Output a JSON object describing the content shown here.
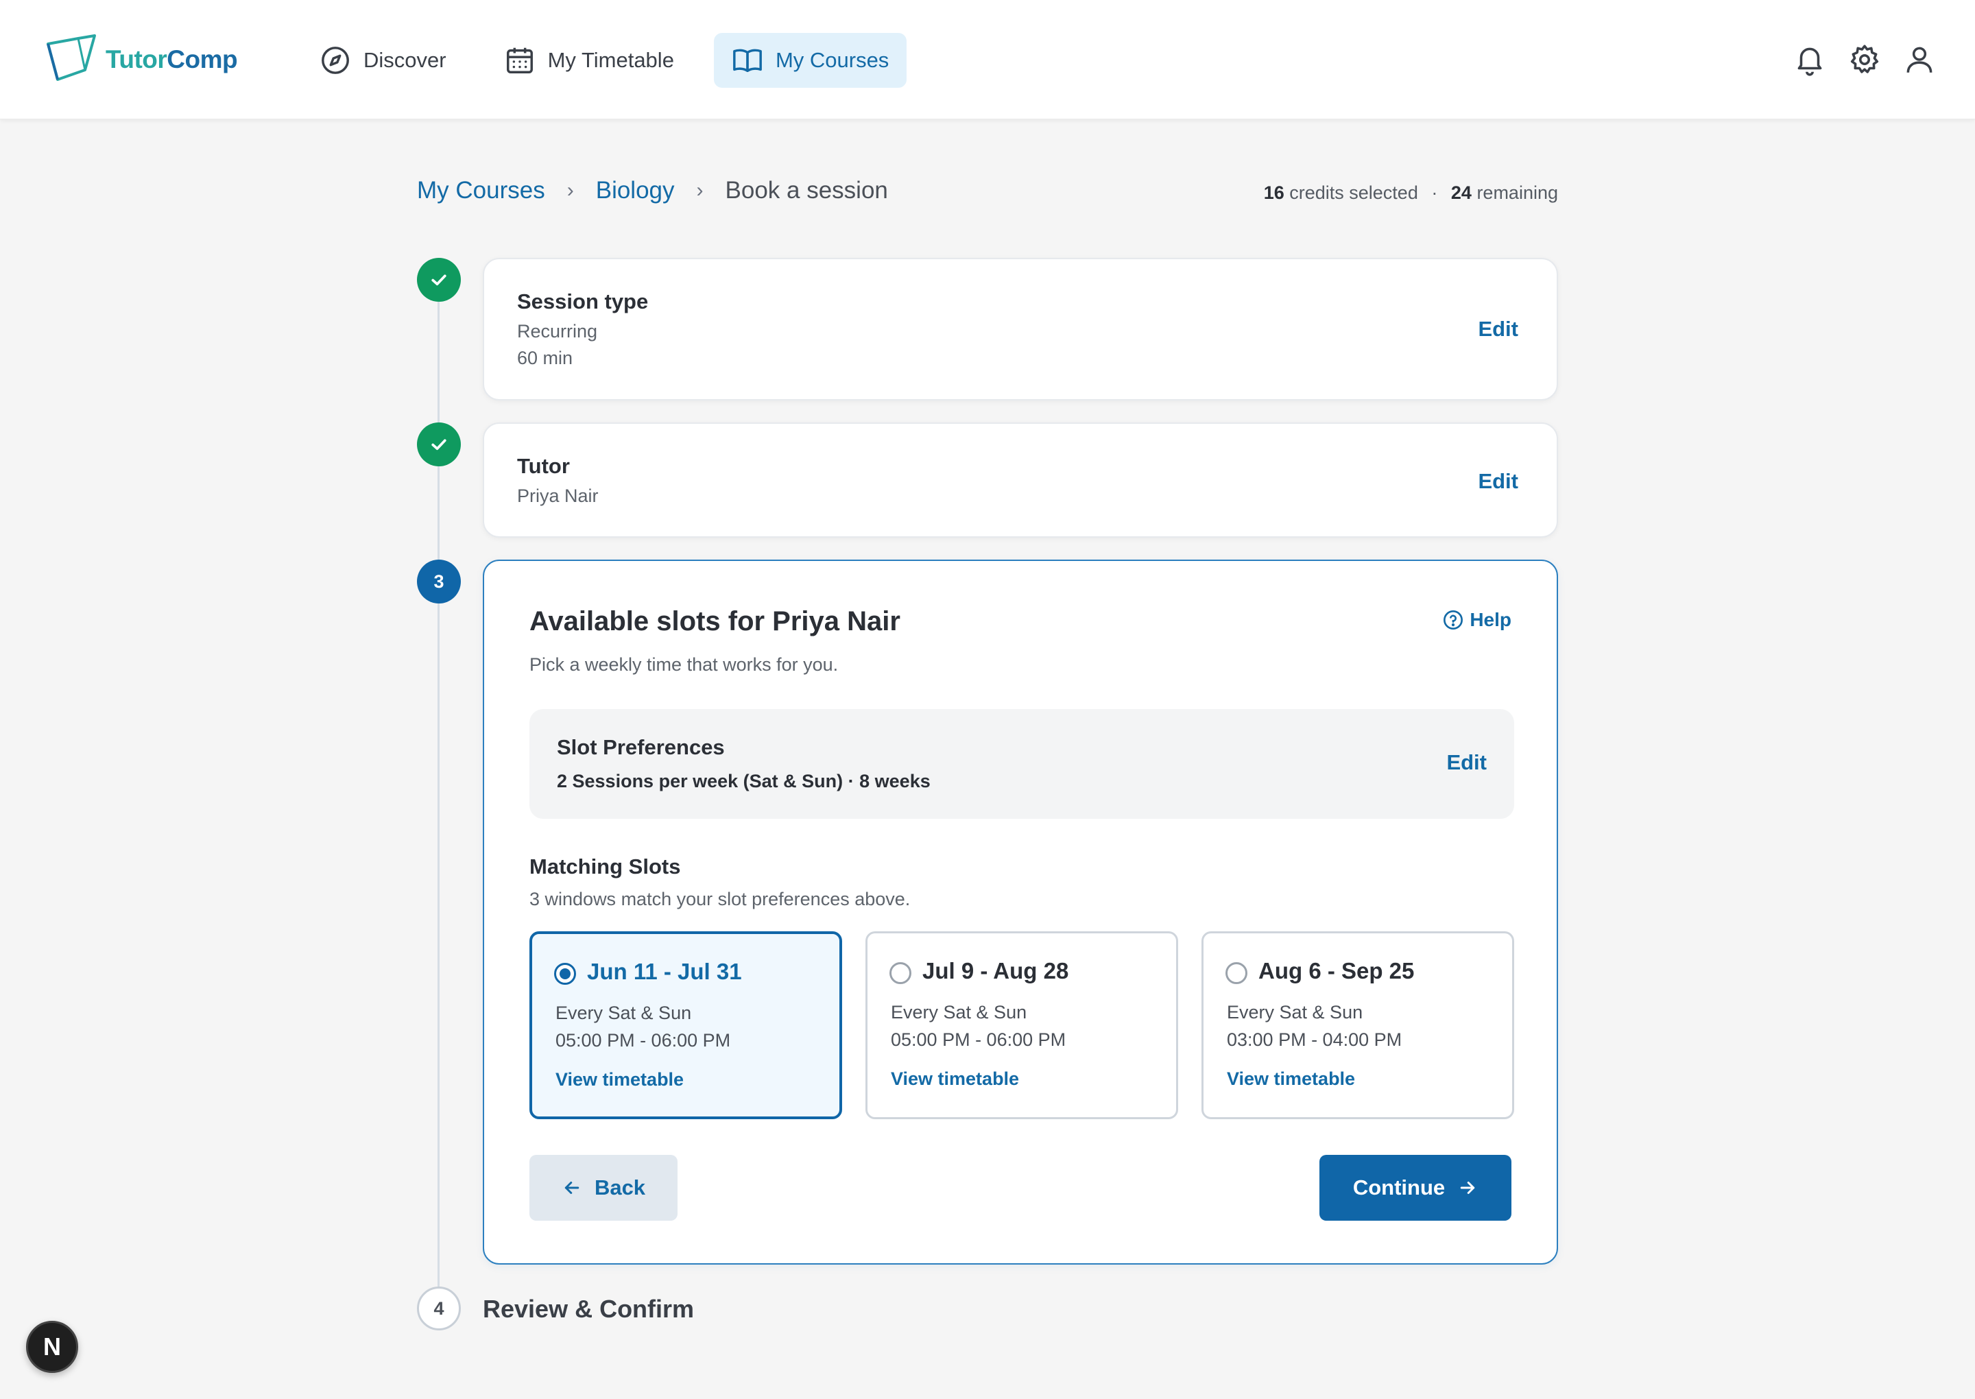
{
  "app": {
    "brand_part1": "Tutor",
    "brand_part2": "Comp",
    "brand_colors": {
      "primary": "#28a7a3",
      "secondary": "#1a6ba4"
    }
  },
  "nav": {
    "items": [
      {
        "label": "Discover",
        "icon": "compass-icon",
        "active": false
      },
      {
        "label": "My Timetable",
        "icon": "calendar-icon",
        "active": false
      },
      {
        "label": "My Courses",
        "icon": "book-open-icon",
        "active": true
      }
    ],
    "actions": [
      "bell-icon",
      "gear-icon",
      "user-icon"
    ]
  },
  "breadcrumb": {
    "items": [
      "My Courses",
      "Biology"
    ],
    "current": "Book a session",
    "separator": "›"
  },
  "credits": {
    "selected_count": "16",
    "selected_text": "credits selected",
    "separator": "·",
    "remaining_count": "24",
    "remaining_text": "remaining"
  },
  "steps": {
    "session_type": {
      "status": "done",
      "title": "Session type",
      "lines": [
        "Recurring",
        "60 min"
      ],
      "edit_label": "Edit"
    },
    "tutor": {
      "status": "done",
      "title": "Tutor",
      "lines": [
        "Priya Nair"
      ],
      "edit_label": "Edit"
    },
    "slots": {
      "number": "3",
      "status": "current",
      "title": "Available slots for Priya Nair",
      "subtitle": "Pick a weekly time that works for you.",
      "help_label": "Help",
      "preferences": {
        "title": "Slot Preferences",
        "detail": "2 Sessions per week (Sat & Sun) · 8 weeks",
        "edit_label": "Edit"
      },
      "matching": {
        "title": "Matching Slots",
        "subtitle": "3 windows match your slot preferences above.",
        "options": [
          {
            "range": "Jun 11 - Jul 31",
            "days": "Every Sat & Sun",
            "time": "05:00 PM - 06:00 PM",
            "link": "View timetable",
            "selected": true
          },
          {
            "range": "Jul 9 - Aug 28",
            "days": "Every Sat & Sun",
            "time": "05:00 PM - 06:00 PM",
            "link": "View timetable",
            "selected": false
          },
          {
            "range": "Aug 6 - Sep 25",
            "days": "Every Sat & Sun",
            "time": "03:00 PM - 04:00 PM",
            "link": "View timetable",
            "selected": false
          }
        ]
      },
      "back_label": "Back",
      "continue_label": "Continue"
    },
    "review": {
      "number": "4",
      "status": "todo",
      "title": "Review & Confirm"
    }
  },
  "dev_badge": {
    "letter": "N"
  },
  "colors": {
    "accent": "#1066a8",
    "success": "#0f9a5f",
    "link": "#136aa6",
    "page_bg": "#f5f5f5"
  }
}
